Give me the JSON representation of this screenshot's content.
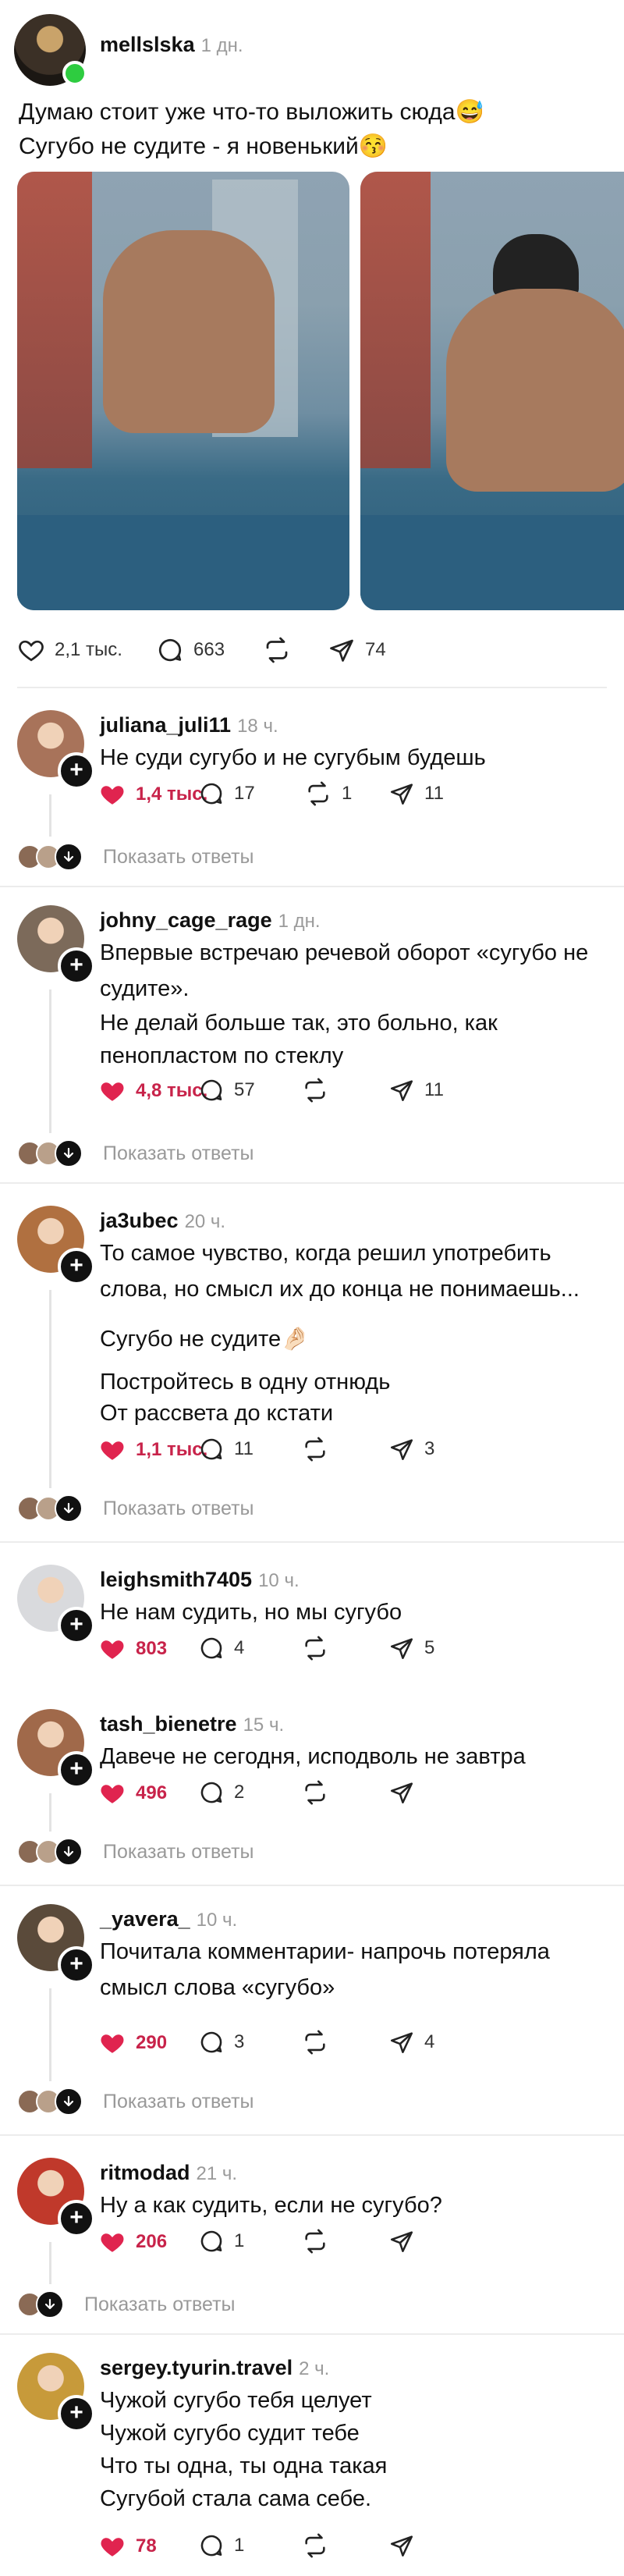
{
  "post": {
    "username": "mellslska",
    "time": "1 дн.",
    "text_line1": "Думаю стоит уже что-то выложить сюда😅",
    "text_line2": "Сугубо не судите - я новенький😚",
    "likes": "2,1 тыс.",
    "comments": "663",
    "shares": "74"
  },
  "comments": [
    {
      "username": "juliana_juli11",
      "time": "18 ч.",
      "lines": [
        "Не суди сугубо и не сугубым будешь"
      ],
      "likes": "1,4 тыс.",
      "comments": "17",
      "reposts": "1",
      "shares": "11",
      "replies": "Показать ответы",
      "avatar_color": "#a8735a"
    },
    {
      "username": "johny_cage_rage",
      "time": "1 дн.",
      "lines": [
        "Впервые встречаю речевой оборот «сугубо не",
        "судите».",
        "Не делай больше так, это больно, как",
        "пенопластом по стеклу"
      ],
      "likes": "4,8 тыс.",
      "comments": "57",
      "reposts": "",
      "shares": "11",
      "replies": "Показать ответы",
      "avatar_color": "#7c6a5a"
    },
    {
      "username": "ja3ubec",
      "time": "20 ч.",
      "lines": [
        "То самое чувство, когда решил употребить",
        "слова, но смысл их до конца не понимаешь...",
        "Сугубо не судите🤌🏻",
        "Постройтесь в одну отнюдь",
        "От рассвета до кстати"
      ],
      "likes": "1,1 тыс.",
      "comments": "11",
      "reposts": "",
      "shares": "3",
      "replies": "Показать ответы",
      "avatar_color": "#b07040"
    },
    {
      "username": "leighsmith7405",
      "time": "10 ч.",
      "lines": [
        "Не нам судить, но мы сугубо"
      ],
      "likes": "803",
      "comments": "4",
      "reposts": "",
      "shares": "5",
      "replies": "",
      "avatar_color": "#d9dadd"
    },
    {
      "username": "tash_bienetre",
      "time": "15 ч.",
      "lines": [
        "Давече не сегодня, исподволь не завтра"
      ],
      "likes": "496",
      "comments": "2",
      "reposts": "",
      "shares": "",
      "replies": "Показать ответы",
      "avatar_color": "#a0694a"
    },
    {
      "username": "_yavera_",
      "time": "10 ч.",
      "lines": [
        "Почитала комментарии- напрочь потеряла",
        "смысл слова «сугубо»"
      ],
      "likes": "290",
      "comments": "3",
      "reposts": "",
      "shares": "4",
      "replies": "Показать ответы",
      "avatar_color": "#5a4a3a"
    },
    {
      "username": "ritmodad",
      "time": "21 ч.",
      "lines": [
        "Ну а как судить, если не сугубо?"
      ],
      "likes": "206",
      "comments": "1",
      "reposts": "",
      "shares": "",
      "replies": "Показать ответы",
      "avatar_color": "#c0392b"
    },
    {
      "username": "sergey.tyurin.travel",
      "time": "2 ч.",
      "lines": [
        "Чужой сугубо тебя целует",
        "Чужой сугубо судит тебе",
        "Что ты одна, ты одна такая",
        "Сугубой стала сама себе."
      ],
      "likes": "78",
      "comments": "1",
      "reposts": "",
      "shares": "",
      "replies": "",
      "avatar_color": "#c79a3a"
    }
  ],
  "colors": {
    "like_red": "#e0244f",
    "likes_text": "#c8234a",
    "online": "#2ecc40"
  }
}
